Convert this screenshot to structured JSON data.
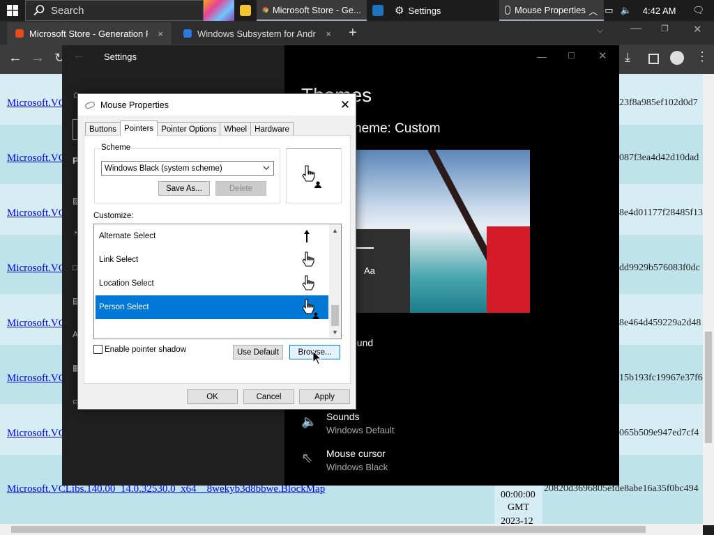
{
  "taskbar": {
    "search_placeholder": "Search",
    "apps": [
      {
        "label": "Microsoft Store - Ge..."
      },
      {
        "label": "Settings"
      },
      {
        "label": "Mouse Properties"
      }
    ],
    "clock": "4:42 AM"
  },
  "browser": {
    "tabs": [
      {
        "title": "Microsoft Store - Generation Project",
        "close": "×"
      },
      {
        "title": "Windows Subsystem for Android",
        "close": "×"
      }
    ],
    "new_tab": "+"
  },
  "page": {
    "rows": [
      {
        "link": "Microsoft.VC",
        "hash": "23f8a985ef102d0d7"
      },
      {
        "link": "Microsoft.VC",
        "hash": "087f3ea4d42d10dad"
      },
      {
        "link": "Microsoft.VC",
        "hash": "8e4d01177f28485f13"
      },
      {
        "link": "Microsoft.VC",
        "hash": "dd9929b576083f0dc"
      },
      {
        "link": "Microsoft.VC",
        "hash": "8e464d459229a2d48"
      },
      {
        "link": "Microsoft.VC",
        "hash": "15b193fc19967e37f6"
      },
      {
        "link": "Microsoft.VC",
        "hash": "065b509e947ed7cf4"
      }
    ],
    "last_row": {
      "link": "Microsoft.VCLibs.140.00_14.0.32530.0_x64__8wekyb3d8bbwe.BlockMap",
      "time": "00:00:00",
      "tz": "GMT",
      "date": "2023-12",
      "hash": "20820d3696805efde8abe16a35f0bc494"
    }
  },
  "settings": {
    "title": "Settings",
    "heading": "Themes",
    "scheme_heading": "heme: Custom",
    "preview_aa": "Aa",
    "background_label": "ound",
    "sounds": {
      "title": "Sounds",
      "value": "Windows Default"
    },
    "mouse_cursor": {
      "title": "Mouse cursor",
      "value": "Windows Black"
    }
  },
  "dialog": {
    "title": "Mouse Properties",
    "tabs": [
      "Buttons",
      "Pointers",
      "Pointer Options",
      "Wheel",
      "Hardware"
    ],
    "active_tab": "Pointers",
    "scheme_legend": "Scheme",
    "scheme_value": "Windows Black (system scheme)",
    "save_as": "Save As...",
    "delete": "Delete",
    "customize_label": "Customize:",
    "items": [
      {
        "label": "Alternate Select",
        "icon": "up-arrow-icon"
      },
      {
        "label": "Link Select",
        "icon": "hand-pointer-icon"
      },
      {
        "label": "Location Select",
        "icon": "hand-pin-pointer-icon"
      },
      {
        "label": "Person Select",
        "icon": "hand-person-pointer-icon"
      }
    ],
    "selected_item": "Person Select",
    "shadow_label": "Enable pointer shadow",
    "shadow_checked": false,
    "use_default": "Use Default",
    "browse": "Browse...",
    "ok": "OK",
    "cancel": "Cancel",
    "apply": "Apply"
  },
  "colors": {
    "accent": "#0078d7",
    "page_bg": "#bfe3ea",
    "link": "#0000ee"
  }
}
